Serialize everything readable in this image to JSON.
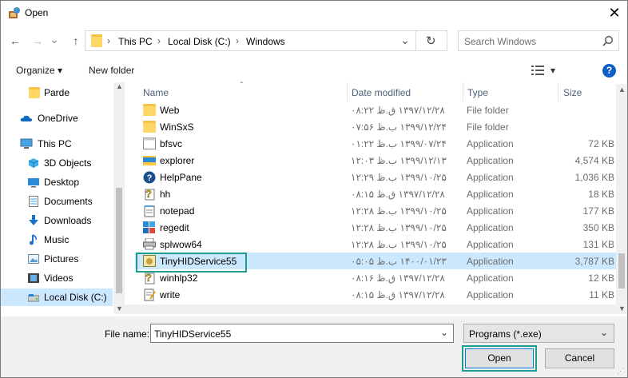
{
  "window": {
    "title": "Open",
    "close": "✕"
  },
  "nav": {
    "back": "←",
    "forward": "→",
    "recent": "⌄",
    "up": "↑",
    "refresh": "↻"
  },
  "address": {
    "crumbs": [
      "This PC",
      "Local Disk (C:)",
      "Windows"
    ],
    "sep": "›",
    "dropdown": "⌄"
  },
  "search": {
    "placeholder": "Search Windows"
  },
  "toolbar": {
    "organize": "Organize ▾",
    "new_folder": "New folder",
    "view": "▾",
    "help": "?"
  },
  "sidebar": {
    "items": [
      {
        "label": "Parde",
        "icon": "folder-icon"
      },
      {
        "label": "OneDrive",
        "icon": "cloud-icon"
      },
      {
        "label": "This PC",
        "icon": "computer-icon"
      },
      {
        "label": "3D Objects",
        "icon": "cube-icon"
      },
      {
        "label": "Desktop",
        "icon": "desktop-icon"
      },
      {
        "label": "Documents",
        "icon": "document-icon"
      },
      {
        "label": "Downloads",
        "icon": "download-icon"
      },
      {
        "label": "Music",
        "icon": "music-icon"
      },
      {
        "label": "Pictures",
        "icon": "picture-icon"
      },
      {
        "label": "Videos",
        "icon": "video-icon"
      },
      {
        "label": "Local Disk (C:)",
        "icon": "drive-icon"
      }
    ]
  },
  "columns": {
    "name": "Name",
    "date": "Date modified",
    "type": "Type",
    "size": "Size"
  },
  "files": [
    {
      "name": "Web",
      "date": "۱۳۹۷/۱۲/۲۸ ق.ظ ۰۸:۲۲",
      "type": "File folder",
      "size": "",
      "icon": "folder"
    },
    {
      "name": "WinSxS",
      "date": "۱۳۹۹/۱۲/۲۴ ب.ظ ۰۷:۵۶",
      "type": "File folder",
      "size": "",
      "icon": "folder"
    },
    {
      "name": "bfsvc",
      "date": "۱۳۹۹/۰۷/۲۴ ب.ظ ۰۱:۲۲",
      "type": "Application",
      "size": "72 KB",
      "icon": "app"
    },
    {
      "name": "explorer",
      "date": "۱۳۹۹/۱۲/۱۳ ب.ظ ۱۲:۰۳",
      "type": "Application",
      "size": "4,574 KB",
      "icon": "explorer"
    },
    {
      "name": "HelpPane",
      "date": "۱۳۹۹/۱۰/۲۵ ب.ظ ۱۲:۲۹",
      "type": "Application",
      "size": "1,036 KB",
      "icon": "help"
    },
    {
      "name": "hh",
      "date": "۱۳۹۷/۱۲/۲۸ ق.ظ ۰۸:۱۵",
      "type": "Application",
      "size": "18 KB",
      "icon": "hh"
    },
    {
      "name": "notepad",
      "date": "۱۳۹۹/۱۰/۲۵ ب.ظ ۱۲:۲۸",
      "type": "Application",
      "size": "177 KB",
      "icon": "notepad"
    },
    {
      "name": "regedit",
      "date": "۱۳۹۹/۱۰/۲۵ ب.ظ ۱۲:۲۸",
      "type": "Application",
      "size": "350 KB",
      "icon": "regedit"
    },
    {
      "name": "splwow64",
      "date": "۱۳۹۹/۱۰/۲۵ ب.ظ ۱۲:۲۸",
      "type": "Application",
      "size": "131 KB",
      "icon": "printer"
    },
    {
      "name": "TinyHIDService55",
      "date": "۱۴۰۰/۰۱/۲۳ ب.ظ ۰۵:۰۵",
      "type": "Application",
      "size": "3,787 KB",
      "icon": "tiny",
      "selected": true
    },
    {
      "name": "winhlp32",
      "date": "۱۳۹۷/۱۲/۲۸ ق.ظ ۰۸:۱۶",
      "type": "Application",
      "size": "12 KB",
      "icon": "hh"
    },
    {
      "name": "write",
      "date": "۱۳۹۷/۱۲/۲۸ ق.ظ ۰۸:۱۵",
      "type": "Application",
      "size": "11 KB",
      "icon": "write"
    }
  ],
  "bottom": {
    "file_name_label": "File name:",
    "file_name_value": "TinyHIDService55",
    "filter": "Programs (*.exe)",
    "open": "Open",
    "cancel": "Cancel"
  },
  "colors": {
    "selection": "#cce8ff",
    "highlight": "#1e9e8f",
    "header_text": "#4c607a"
  }
}
